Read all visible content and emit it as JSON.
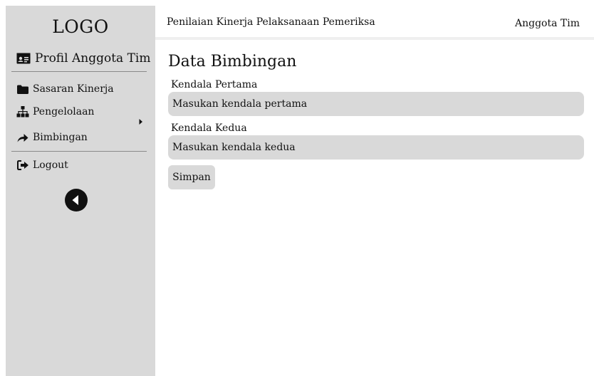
{
  "sidebar": {
    "logo": "LOGO",
    "profile_label": "Profil Anggota Tim",
    "items": [
      {
        "label": "Sasaran Kinerja",
        "icon": "folder-icon"
      },
      {
        "label": "Pengelolaan",
        "icon": "sitemap-icon",
        "has_submenu": true
      },
      {
        "label": "Bimbingan",
        "icon": "share-arrow-icon"
      },
      {
        "label": "Logout",
        "icon": "sign-out-icon"
      }
    ],
    "collapse_icon": "circle-arrow-left-icon"
  },
  "header": {
    "title": "Penilaian Kinerja Pelaksanaan Pemeriksa",
    "role": "Anggota Tim"
  },
  "main": {
    "title": "Data Bimbingan",
    "fields": [
      {
        "label": "Kendala Pertama",
        "placeholder": "Masukan kendala pertama"
      },
      {
        "label": "Kendala Kedua",
        "placeholder": "Masukan kendala kedua"
      }
    ],
    "save_label": "Simpan"
  },
  "colors": {
    "sidebar_bg": "#d9d9d9",
    "input_bg": "#d9d9d9",
    "text": "#111111"
  }
}
